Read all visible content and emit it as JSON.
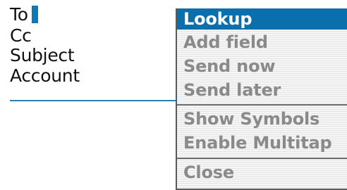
{
  "compose": {
    "fields": [
      {
        "label": "To"
      },
      {
        "label": "Cc"
      },
      {
        "label": "Subject"
      },
      {
        "label": "Account"
      }
    ]
  },
  "menu": {
    "selected_index": 0,
    "items": [
      {
        "label": "Lookup"
      },
      {
        "label": "Add field"
      },
      {
        "label": "Send now"
      },
      {
        "label": "Send later"
      },
      {
        "label": "Show Symbols"
      },
      {
        "label": "Enable Multitap"
      },
      {
        "label": "Close"
      }
    ]
  },
  "colors": {
    "accent": "#0b6fae",
    "cursor": "#0a7bb6",
    "menu_text": "#8a8a8a",
    "field_text": "#111111"
  }
}
